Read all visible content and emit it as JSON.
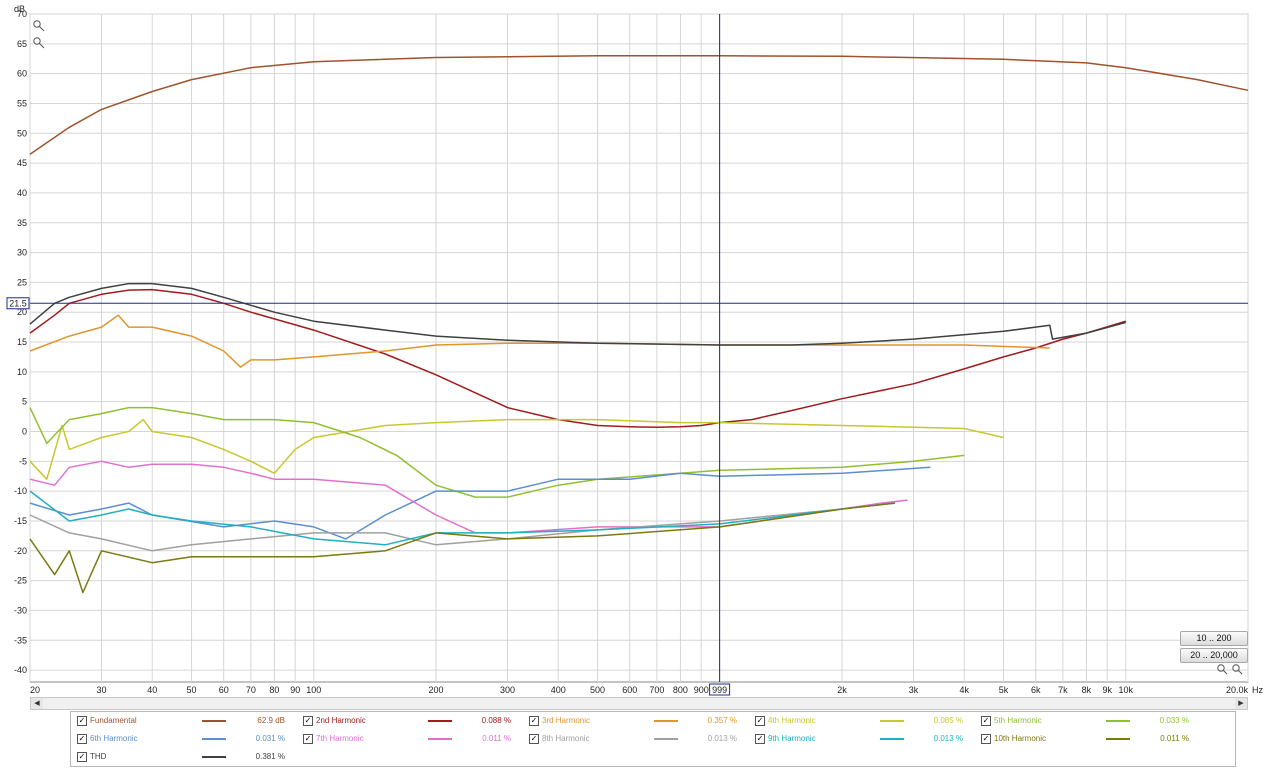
{
  "chart_data": {
    "type": "line",
    "ylabel": "dB",
    "xlabel": "Hz",
    "x_scale": "log",
    "xlim": [
      20,
      20000
    ],
    "ylim": [
      -42,
      70
    ],
    "grid": true,
    "y_ticks": [
      70,
      65,
      60,
      55,
      50,
      45,
      40,
      35,
      30,
      25,
      20,
      15,
      10,
      5,
      0,
      -5,
      -10,
      -15,
      -20,
      -25,
      -30,
      -35,
      -40
    ],
    "x_ticks": [
      {
        "v": 20,
        "t": "20"
      },
      {
        "v": 30,
        "t": "30"
      },
      {
        "v": 40,
        "t": "40"
      },
      {
        "v": 50,
        "t": "50"
      },
      {
        "v": 60,
        "t": "60"
      },
      {
        "v": 70,
        "t": "70"
      },
      {
        "v": 80,
        "t": "80"
      },
      {
        "v": 90,
        "t": "90"
      },
      {
        "v": 100,
        "t": "100"
      },
      {
        "v": 200,
        "t": "200"
      },
      {
        "v": 300,
        "t": "300"
      },
      {
        "v": 400,
        "t": "400"
      },
      {
        "v": 500,
        "t": "500"
      },
      {
        "v": 600,
        "t": "600"
      },
      {
        "v": 700,
        "t": "700"
      },
      {
        "v": 800,
        "t": "800"
      },
      {
        "v": 900,
        "t": "900"
      },
      {
        "v": 2000,
        "t": "2k"
      },
      {
        "v": 3000,
        "t": "3k"
      },
      {
        "v": 4000,
        "t": "4k"
      },
      {
        "v": 5000,
        "t": "5k"
      },
      {
        "v": 6000,
        "t": "6k"
      },
      {
        "v": 7000,
        "t": "7k"
      },
      {
        "v": 8000,
        "t": "8k"
      },
      {
        "v": 9000,
        "t": "9k"
      },
      {
        "v": 10000,
        "t": "10k"
      },
      {
        "v": 20000,
        "t": "20.0k"
      }
    ],
    "cursor": {
      "x": 999,
      "x_label": "999",
      "y": 21.5,
      "y_label": "21.5"
    },
    "series": [
      {
        "name": "Fundamental",
        "value": "62.9 dB",
        "color": "#a0522d",
        "points": [
          [
            20,
            46.5
          ],
          [
            25,
            51
          ],
          [
            30,
            54
          ],
          [
            40,
            57
          ],
          [
            50,
            59
          ],
          [
            70,
            61
          ],
          [
            100,
            62
          ],
          [
            200,
            62.7
          ],
          [
            500,
            63
          ],
          [
            1000,
            63
          ],
          [
            2000,
            62.9
          ],
          [
            5000,
            62.4
          ],
          [
            8000,
            61.8
          ],
          [
            10000,
            61
          ],
          [
            15000,
            59
          ],
          [
            20000,
            57.2
          ]
        ]
      },
      {
        "name": "2nd Harmonic",
        "value": "0.088 %",
        "color": "#a01c1c",
        "points": [
          [
            20,
            16.5
          ],
          [
            23,
            19.5
          ],
          [
            25,
            21.5
          ],
          [
            30,
            23
          ],
          [
            35,
            23.7
          ],
          [
            40,
            23.8
          ],
          [
            50,
            23
          ],
          [
            60,
            21.5
          ],
          [
            70,
            20
          ],
          [
            100,
            17
          ],
          [
            150,
            13
          ],
          [
            200,
            9.5
          ],
          [
            300,
            4
          ],
          [
            400,
            2
          ],
          [
            500,
            1
          ],
          [
            600,
            0.8
          ],
          [
            700,
            0.7
          ],
          [
            800,
            0.8
          ],
          [
            900,
            1
          ],
          [
            1000,
            1.5
          ],
          [
            1200,
            2
          ],
          [
            1500,
            3.5
          ],
          [
            2000,
            5.5
          ],
          [
            3000,
            8
          ],
          [
            4000,
            10.5
          ],
          [
            5000,
            12.5
          ],
          [
            6000,
            14
          ],
          [
            7000,
            15.5
          ],
          [
            8000,
            16.5
          ],
          [
            10000,
            18.5
          ]
        ]
      },
      {
        "name": "3rd Harmonic",
        "value": "0.357 %",
        "color": "#e0962a",
        "points": [
          [
            20,
            13.5
          ],
          [
            25,
            16
          ],
          [
            30,
            17.5
          ],
          [
            33,
            19.5
          ],
          [
            35,
            17.5
          ],
          [
            40,
            17.5
          ],
          [
            50,
            16
          ],
          [
            60,
            13.5
          ],
          [
            66,
            10.8
          ],
          [
            70,
            12
          ],
          [
            80,
            12
          ],
          [
            100,
            12.5
          ],
          [
            150,
            13.5
          ],
          [
            200,
            14.5
          ],
          [
            300,
            14.8
          ],
          [
            500,
            14.8
          ],
          [
            1000,
            14.5
          ],
          [
            2000,
            14.5
          ],
          [
            4000,
            14.5
          ],
          [
            6500,
            14
          ]
        ]
      },
      {
        "name": "4th Harmonic",
        "value": "0.085 %",
        "color": "#c8c830",
        "points": [
          [
            20,
            -5
          ],
          [
            22,
            -8
          ],
          [
            24,
            1
          ],
          [
            25,
            -3
          ],
          [
            30,
            -1
          ],
          [
            35,
            0
          ],
          [
            38,
            2
          ],
          [
            40,
            0
          ],
          [
            50,
            -1
          ],
          [
            60,
            -3
          ],
          [
            70,
            -5
          ],
          [
            80,
            -7
          ],
          [
            90,
            -3
          ],
          [
            100,
            -1
          ],
          [
            150,
            1
          ],
          [
            200,
            1.5
          ],
          [
            300,
            2
          ],
          [
            500,
            2
          ],
          [
            800,
            1.5
          ],
          [
            1000,
            1.5
          ],
          [
            2000,
            1
          ],
          [
            4000,
            0.5
          ],
          [
            5000,
            -1
          ]
        ]
      },
      {
        "name": "5th Harmonic",
        "value": "0.033 %",
        "color": "#90c030",
        "points": [
          [
            20,
            4
          ],
          [
            22,
            -2
          ],
          [
            25,
            2
          ],
          [
            30,
            3
          ],
          [
            35,
            4
          ],
          [
            40,
            4
          ],
          [
            50,
            3
          ],
          [
            60,
            2
          ],
          [
            80,
            2
          ],
          [
            100,
            1.5
          ],
          [
            130,
            -1
          ],
          [
            160,
            -4
          ],
          [
            200,
            -9
          ],
          [
            250,
            -11
          ],
          [
            300,
            -11
          ],
          [
            400,
            -9
          ],
          [
            500,
            -8
          ],
          [
            800,
            -7
          ],
          [
            1000,
            -6.5
          ],
          [
            2000,
            -6
          ],
          [
            3000,
            -5
          ],
          [
            4000,
            -4
          ]
        ]
      },
      {
        "name": "6th Harmonic",
        "value": "0.031 %",
        "color": "#5b8fd0",
        "points": [
          [
            20,
            -12
          ],
          [
            25,
            -14
          ],
          [
            30,
            -13
          ],
          [
            35,
            -12
          ],
          [
            40,
            -14
          ],
          [
            60,
            -16
          ],
          [
            80,
            -15
          ],
          [
            100,
            -16
          ],
          [
            120,
            -18
          ],
          [
            150,
            -14
          ],
          [
            200,
            -10
          ],
          [
            250,
            -10
          ],
          [
            300,
            -10
          ],
          [
            400,
            -8
          ],
          [
            600,
            -8
          ],
          [
            800,
            -7
          ],
          [
            1000,
            -7.5
          ],
          [
            2000,
            -7
          ],
          [
            3300,
            -6
          ]
        ]
      },
      {
        "name": "7th Harmonic",
        "value": "0.011 %",
        "color": "#e070d0",
        "points": [
          [
            20,
            -8
          ],
          [
            23,
            -9
          ],
          [
            25,
            -6
          ],
          [
            30,
            -5
          ],
          [
            35,
            -6
          ],
          [
            40,
            -5.5
          ],
          [
            50,
            -5.5
          ],
          [
            60,
            -6
          ],
          [
            70,
            -7
          ],
          [
            80,
            -8
          ],
          [
            100,
            -8
          ],
          [
            150,
            -9
          ],
          [
            200,
            -14
          ],
          [
            250,
            -17
          ],
          [
            300,
            -17
          ],
          [
            500,
            -16
          ],
          [
            1000,
            -16
          ],
          [
            2000,
            -13
          ],
          [
            2500,
            -12
          ],
          [
            2900,
            -11.5
          ]
        ]
      },
      {
        "name": "8th Harmonic",
        "value": "0.013 %",
        "color": "#a0a0a0",
        "points": [
          [
            20,
            -14
          ],
          [
            25,
            -17
          ],
          [
            30,
            -18
          ],
          [
            40,
            -20
          ],
          [
            50,
            -19
          ],
          [
            70,
            -18
          ],
          [
            100,
            -17
          ],
          [
            150,
            -17
          ],
          [
            200,
            -19
          ],
          [
            300,
            -18
          ],
          [
            500,
            -16.5
          ],
          [
            1000,
            -15
          ],
          [
            2000,
            -13
          ],
          [
            2700,
            -12
          ]
        ]
      },
      {
        "name": "9th Harmonic",
        "value": "0.013 %",
        "color": "#20b0c0",
        "points": [
          [
            20,
            -10
          ],
          [
            25,
            -15
          ],
          [
            30,
            -14
          ],
          [
            35,
            -13
          ],
          [
            40,
            -14
          ],
          [
            50,
            -15
          ],
          [
            70,
            -16
          ],
          [
            100,
            -18
          ],
          [
            150,
            -19
          ],
          [
            200,
            -17
          ],
          [
            300,
            -17
          ],
          [
            500,
            -16.5
          ],
          [
            1000,
            -15.5
          ],
          [
            2000,
            -13
          ],
          [
            2700,
            -12
          ]
        ]
      },
      {
        "name": "10th Harmonic",
        "value": "0.011 %",
        "color": "#7a7a10",
        "points": [
          [
            20,
            -18
          ],
          [
            23,
            -24
          ],
          [
            25,
            -20
          ],
          [
            27,
            -27
          ],
          [
            30,
            -20
          ],
          [
            40,
            -22
          ],
          [
            50,
            -21
          ],
          [
            70,
            -21
          ],
          [
            100,
            -21
          ],
          [
            150,
            -20
          ],
          [
            200,
            -17
          ],
          [
            300,
            -18
          ],
          [
            500,
            -17.5
          ],
          [
            1000,
            -16
          ],
          [
            2000,
            -13
          ],
          [
            2700,
            -12
          ]
        ]
      },
      {
        "name": "THD",
        "value": "0.381 %",
        "color": "#404040",
        "points": [
          [
            20,
            18
          ],
          [
            23,
            21.5
          ],
          [
            25,
            22.5
          ],
          [
            30,
            24
          ],
          [
            35,
            24.8
          ],
          [
            40,
            24.8
          ],
          [
            50,
            24
          ],
          [
            60,
            22.5
          ],
          [
            80,
            20
          ],
          [
            100,
            18.5
          ],
          [
            150,
            17
          ],
          [
            200,
            16
          ],
          [
            300,
            15.3
          ],
          [
            500,
            14.8
          ],
          [
            1000,
            14.5
          ],
          [
            1500,
            14.5
          ],
          [
            2000,
            14.8
          ],
          [
            3000,
            15.5
          ],
          [
            5000,
            16.8
          ],
          [
            6500,
            17.8
          ],
          [
            6600,
            15.5
          ],
          [
            8000,
            16.5
          ],
          [
            10000,
            18.3
          ]
        ]
      }
    ]
  },
  "buttons": {
    "range_10_200": "10 .. 200",
    "range_20_20000": "20 .. 20,000"
  }
}
